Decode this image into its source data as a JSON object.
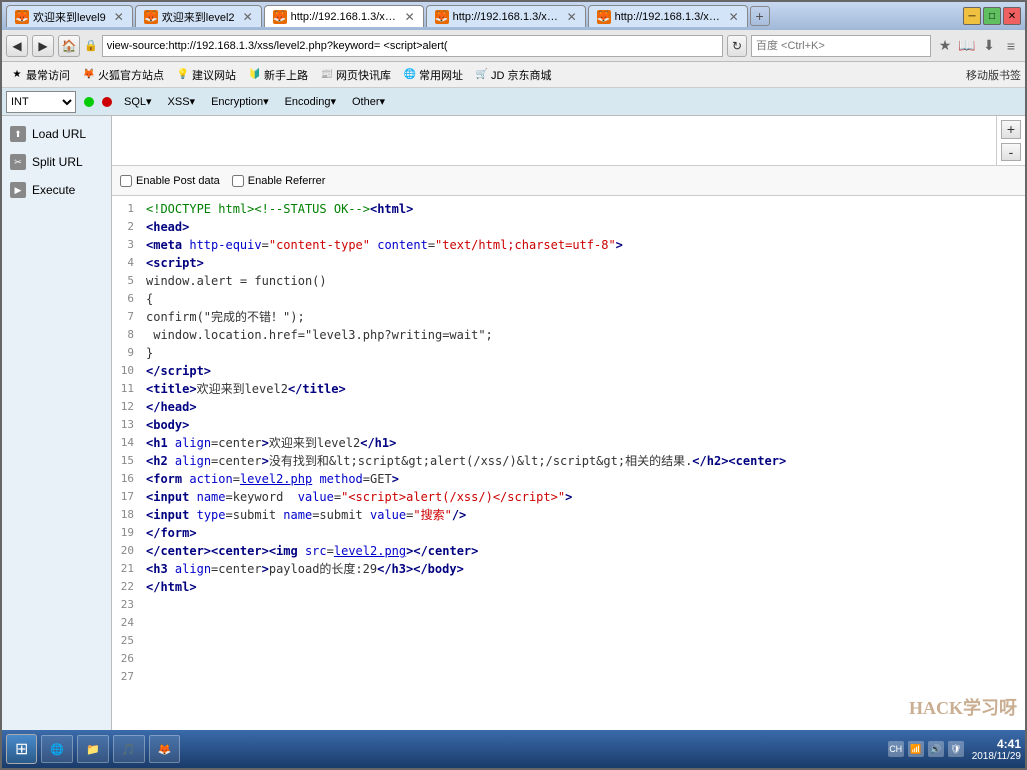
{
  "window": {
    "title": "Firefox Browser"
  },
  "tabs": [
    {
      "id": "tab1",
      "label": "欢迎来到level9",
      "active": false,
      "icon": "ff"
    },
    {
      "id": "tab2",
      "label": "欢迎来到level2",
      "active": false,
      "icon": "ff"
    },
    {
      "id": "tab3",
      "label": "http://192.168.1.3/xs...",
      "active": true,
      "icon": "ff"
    },
    {
      "id": "tab4",
      "label": "http://192.168.1.3/xs...",
      "active": false,
      "icon": "ff"
    },
    {
      "id": "tab5",
      "label": "http://192.168.1.3/xs...",
      "active": false,
      "icon": "ff"
    }
  ],
  "address_bar": {
    "url": "view-source:http://192.168.1.3/xss/level2.php?keyword= <script>alert(",
    "search_placeholder": "百度 <Ctrl+K>"
  },
  "bookmarks": [
    {
      "label": "最常访问",
      "icon": "★"
    },
    {
      "label": "火狐官方站点",
      "icon": "🦊"
    },
    {
      "label": "建议网站",
      "icon": "💡"
    },
    {
      "label": "新手上路",
      "icon": "🔰"
    },
    {
      "label": "网页快讯库",
      "icon": "📰"
    },
    {
      "label": "常用网址",
      "icon": "🌐"
    },
    {
      "label": "JD 京东商城",
      "icon": "🛒"
    }
  ],
  "mobile_btn": "移动版书签",
  "toolbar": {
    "int_select": "INT",
    "menus": [
      "SQL▾",
      "XSS▾",
      "Encryption▾",
      "Encoding▾",
      "Other▾"
    ]
  },
  "sidebar": {
    "items": [
      {
        "label": "Load URL",
        "icon": "⬆"
      },
      {
        "label": "Split URL",
        "icon": "✂"
      },
      {
        "label": "Execute",
        "icon": "▶"
      }
    ]
  },
  "options": {
    "enable_post": "Enable Post data",
    "enable_referrer": "Enable Referrer"
  },
  "code_lines": [
    {
      "num": 1,
      "html": "<span class='code-comment'>&lt;!DOCTYPE html&gt;&lt;!--STATUS OK--&gt;</span><span class='code-tag'>&lt;html&gt;</span>"
    },
    {
      "num": 2,
      "html": "<span class='code-tag'>&lt;head&gt;</span>"
    },
    {
      "num": 3,
      "html": "<span class='code-tag'>&lt;meta</span> <span class='code-attr'>http-equiv</span>=<span class='code-value'>\"content-type\"</span> <span class='code-attr'>content</span>=<span class='code-value'>\"text/html;charset=utf-8\"</span><span class='code-tag'>&gt;</span>"
    },
    {
      "num": 4,
      "html": "<span class='code-tag'>&lt;script&gt;</span>"
    },
    {
      "num": 5,
      "html": "window.alert = function()"
    },
    {
      "num": 6,
      "html": "{"
    },
    {
      "num": 7,
      "html": "confirm(\"完成的不错！\");"
    },
    {
      "num": 8,
      "html": " window.location.href=\"level3.php?writing=wait\";"
    },
    {
      "num": 9,
      "html": "}"
    },
    {
      "num": 10,
      "html": "<span class='code-tag'>&lt;/script&gt;</span>"
    },
    {
      "num": 11,
      "html": "<span class='code-tag'>&lt;title&gt;</span>欢迎来到level2<span class='code-tag'>&lt;/title&gt;</span>"
    },
    {
      "num": 12,
      "html": "<span class='code-tag'>&lt;/head&gt;</span>"
    },
    {
      "num": 13,
      "html": "<span class='code-tag'>&lt;body&gt;</span>"
    },
    {
      "num": 14,
      "html": "<span class='code-tag'>&lt;h1</span> <span class='code-attr'>align</span>=center<span class='code-tag'>&gt;</span>欢迎来到level2<span class='code-tag'>&lt;/h1&gt;</span>"
    },
    {
      "num": 15,
      "html": "<span class='code-tag'>&lt;h2</span> <span class='code-attr'>align</span>=center<span class='code-tag'>&gt;</span>没有找到和&amp;lt;script&amp;gt;alert(/xss/)&amp;lt;/script&amp;gt;相关的结果.<span class='code-tag'>&lt;/h2&gt;&lt;center&gt;</span>"
    },
    {
      "num": 16,
      "html": "<span class='code-tag'>&lt;form</span> <span class='code-attr'>action</span>=<span class='code-link'>level2.php</span> <span class='code-attr'>method</span>=GET<span class='code-tag'>&gt;</span>"
    },
    {
      "num": 17,
      "html": "<span class='code-tag'>&lt;input</span> <span class='code-attr'>name</span>=keyword  <span class='code-attr'>value</span>=<span class='code-value'>\"&lt;script&gt;alert(/xss/)&lt;/script&gt;\"</span><span class='code-tag'>&gt;</span>"
    },
    {
      "num": 18,
      "html": "<span class='code-tag'>&lt;input</span> <span class='code-attr'>type</span>=submit <span class='code-attr'>name</span>=submit <span class='code-attr'>value</span>=<span class='code-value'>\"搜索\"</span><span class='code-tag'>/&gt;</span>"
    },
    {
      "num": 19,
      "html": "<span class='code-tag'>&lt;/form&gt;</span>"
    },
    {
      "num": 20,
      "html": "<span class='code-tag'>&lt;/center&gt;&lt;center&gt;&lt;img</span> <span class='code-attr'>src</span>=<span class='code-link'>level2.png</span><span class='code-tag'>&gt;&lt;/center&gt;</span>"
    },
    {
      "num": 21,
      "html": "<span class='code-tag'>&lt;h3</span> <span class='code-attr'>align</span>=center<span class='code-tag'>&gt;</span>payload的长度:29<span class='code-tag'>&lt;/h3&gt;&lt;/body&gt;</span>"
    },
    {
      "num": 22,
      "html": "<span class='code-tag'>&lt;/html&gt;</span>"
    },
    {
      "num": 23,
      "html": ""
    },
    {
      "num": 24,
      "html": ""
    },
    {
      "num": 25,
      "html": ""
    },
    {
      "num": 26,
      "html": ""
    },
    {
      "num": 27,
      "html": ""
    }
  ],
  "taskbar": {
    "start_label": "Start",
    "items": [
      "Firefox"
    ]
  },
  "clock": {
    "time": "4:41",
    "date": "2018/11/29"
  },
  "watermark": "HACK学习呀"
}
